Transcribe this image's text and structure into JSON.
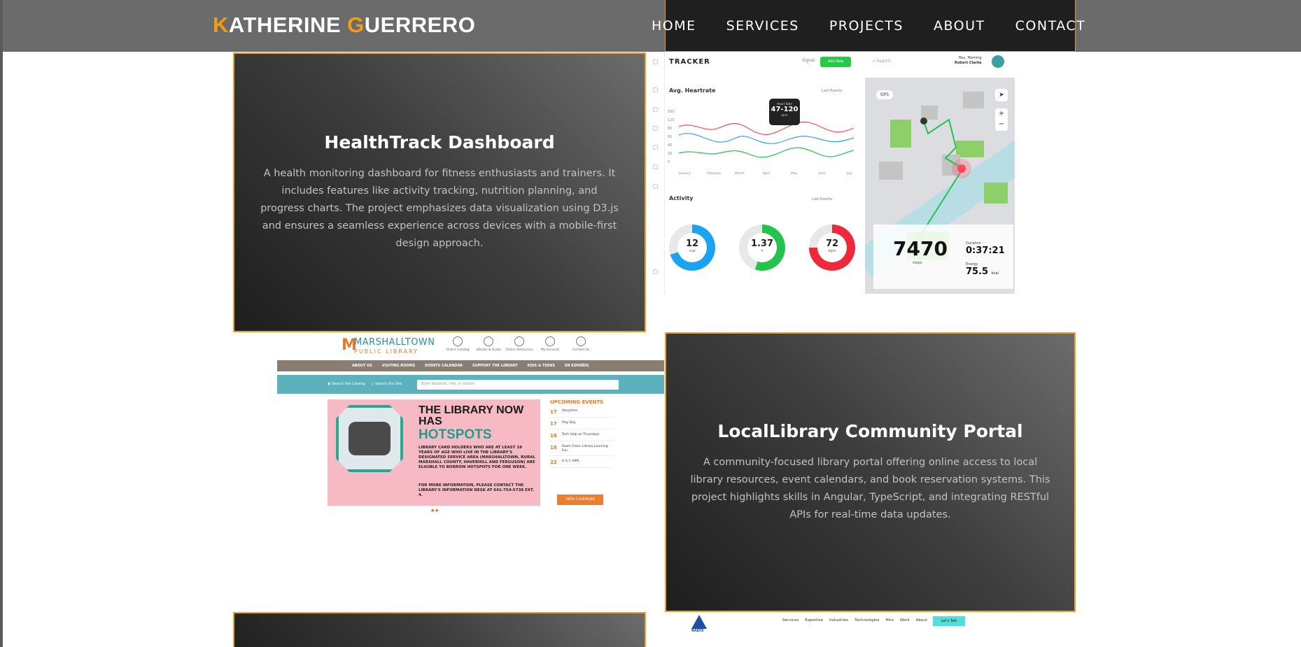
{
  "header": {
    "logo_first_initial": "K",
    "logo_first_rest": "ATHERINE",
    "logo_last_initial": "G",
    "logo_last_rest": "UERRERO",
    "nav": [
      "HOME",
      "SERVICES",
      "PROJECTS",
      "ABOUT",
      "CONTACT"
    ]
  },
  "colors": {
    "accent": "#f39c12",
    "header_bg": "#6b6b6b",
    "card_border": "#f0a020"
  },
  "projects": [
    {
      "title": "HealthTrack Dashboard",
      "description": "A health monitoring dashboard for fitness enthusiasts and trainers. It includes features like activity tracking, nutrition planning, and progress charts. The project emphasizes data visualization using D3.js and ensures a seamless experience across devices with a mobile-first design approach."
    },
    {
      "title": "LocalLibrary Community Portal",
      "description": "A community-focused library portal offering online access to local library resources, event calendars, and book reservation systems. This project highlights skills in Angular, TypeScript, and integrating RESTful APIs for real-time data updates."
    }
  ],
  "health_shot": {
    "logo": "TRACKER",
    "signal": "Signal",
    "action": "Add New",
    "search": "Search",
    "user_greeting": "Hey, Morning",
    "user_name": "Robert Clarke",
    "heartrate_title": "Avg. Heartrate",
    "range_label": "Last Events",
    "tooltip_label": "Heart Rate",
    "tooltip_value": "47-120",
    "tooltip_unit": "bpm",
    "months": [
      "January",
      "February",
      "March",
      "April",
      "May",
      "June",
      "July"
    ],
    "y_ticks": [
      "100",
      "120",
      "80",
      "60",
      "40",
      "20",
      "0"
    ],
    "activity_title": "Activity",
    "donuts": [
      {
        "value": "12",
        "unit": "cup",
        "fraction": 0.7,
        "color": "#1aa3f0"
      },
      {
        "value": "1.37",
        "unit": "h",
        "fraction": 0.55,
        "color": "#22c44a"
      },
      {
        "value": "72",
        "unit": "bpm",
        "fraction": 0.75,
        "color": "#f0283c"
      }
    ],
    "gps": "GPS",
    "steps": "7470",
    "steps_unit": "steps",
    "duration_label": "Duration",
    "duration_value": "0:37:21",
    "energy_label": "Energy",
    "energy_value": "75.5",
    "energy_unit": "kcal"
  },
  "library_shot": {
    "logo_line1": "MARSHALLTOWN",
    "logo_line2": "PUBLIC LIBRARY",
    "top_icons": [
      "Online Catalog",
      "eBooks & Audio",
      "Online Resources",
      "My Account",
      "Contact Us"
    ],
    "nav": [
      "ABOUT US",
      "VISITING ROOMS",
      "EVENTS CALENDAR",
      "SUPPORT THE LIBRARY",
      "KIDS & TEENS",
      "EN ESPAÑOL"
    ],
    "radio_catalog": "Search the Catalog",
    "radio_site": "Search the Site",
    "search_placeholder": "Enter Keyword, title, or author",
    "banner_head": "THE LIBRARY NOW HAS",
    "banner_head2": "HOTSPOTS",
    "banner_body": "LIBRARY CARD HOLDERS WHO ARE AT LEAST 18 YEARS OF AGE WHO LIVE IN THE LIBRARY'S DESIGNATED SERVICE AREA (MARSHALLTOWN, RURAL MARSHALL COUNTY, HAVERHILL AND FERGUSON) ARE ELIGIBLE TO BORROW HOTSPOTS FOR ONE WEEK.",
    "banner_body2": "FOR MORE INFORMATION, PLEASE CONTACT THE LIBRARY'S INFORMATION DESK AT 641-754-5738 EXT. 4.",
    "events_title": "UPCOMING EVENTS",
    "events": [
      {
        "day": "17",
        "text": "Storytime"
      },
      {
        "day": "17",
        "text": "Play Day"
      },
      {
        "day": "18",
        "text": "Tech Help on Thursdays"
      },
      {
        "day": "18",
        "text": "Zoom Class: Library Learning Fun"
      },
      {
        "day": "22",
        "text": "It is 1 (HM)"
      }
    ],
    "calendar_button": "VIEW CALENDAR"
  },
  "radix_shot": {
    "logo": "RADIX",
    "nav": [
      "Services",
      "Expertise",
      "Industries",
      "Technologies",
      "Hire",
      "Work",
      "About"
    ],
    "cta": "Let's Talk"
  }
}
